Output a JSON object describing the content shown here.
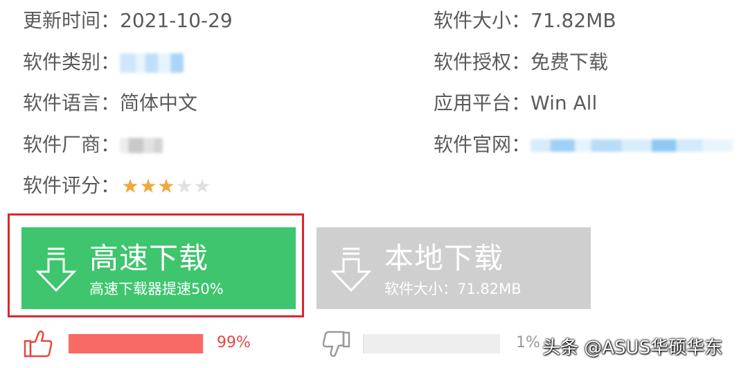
{
  "info": {
    "update_label": "更新时间：",
    "update_value": "2021-10-29",
    "size_label": "软件大小：",
    "size_value": "71.82MB",
    "category_label": "软件类别：",
    "license_label": "软件授权：",
    "license_value": "免费下载",
    "language_label": "软件语言：",
    "language_value": "简体中文",
    "platform_label": "应用平台：",
    "platform_value": "Win All",
    "vendor_label": "软件厂商：",
    "website_label": "软件官网：",
    "rating_label": "软件评分：",
    "rating_stars": 3,
    "rating_max": 5
  },
  "downloads": {
    "fast": {
      "title": "高速下载",
      "subtitle": "高速下载器提速50%",
      "color": "#3ec56e"
    },
    "local": {
      "title": "本地下载",
      "subtitle": "软件大小：71.82MB",
      "color": "#cfcfcf"
    }
  },
  "votes": {
    "up_percent_text": "99%",
    "up_fraction": 0.99,
    "up_color": "#f86a66",
    "down_percent_text": "1%",
    "down_fraction": 0.01,
    "down_color": "#e6e6e6"
  },
  "watermark": "头条 @ASUS华硕华东",
  "icons": {
    "download": "download-arrow-icon",
    "like": "thumbs-up-icon",
    "dislike": "thumbs-down-icon",
    "star": "star-icon"
  }
}
